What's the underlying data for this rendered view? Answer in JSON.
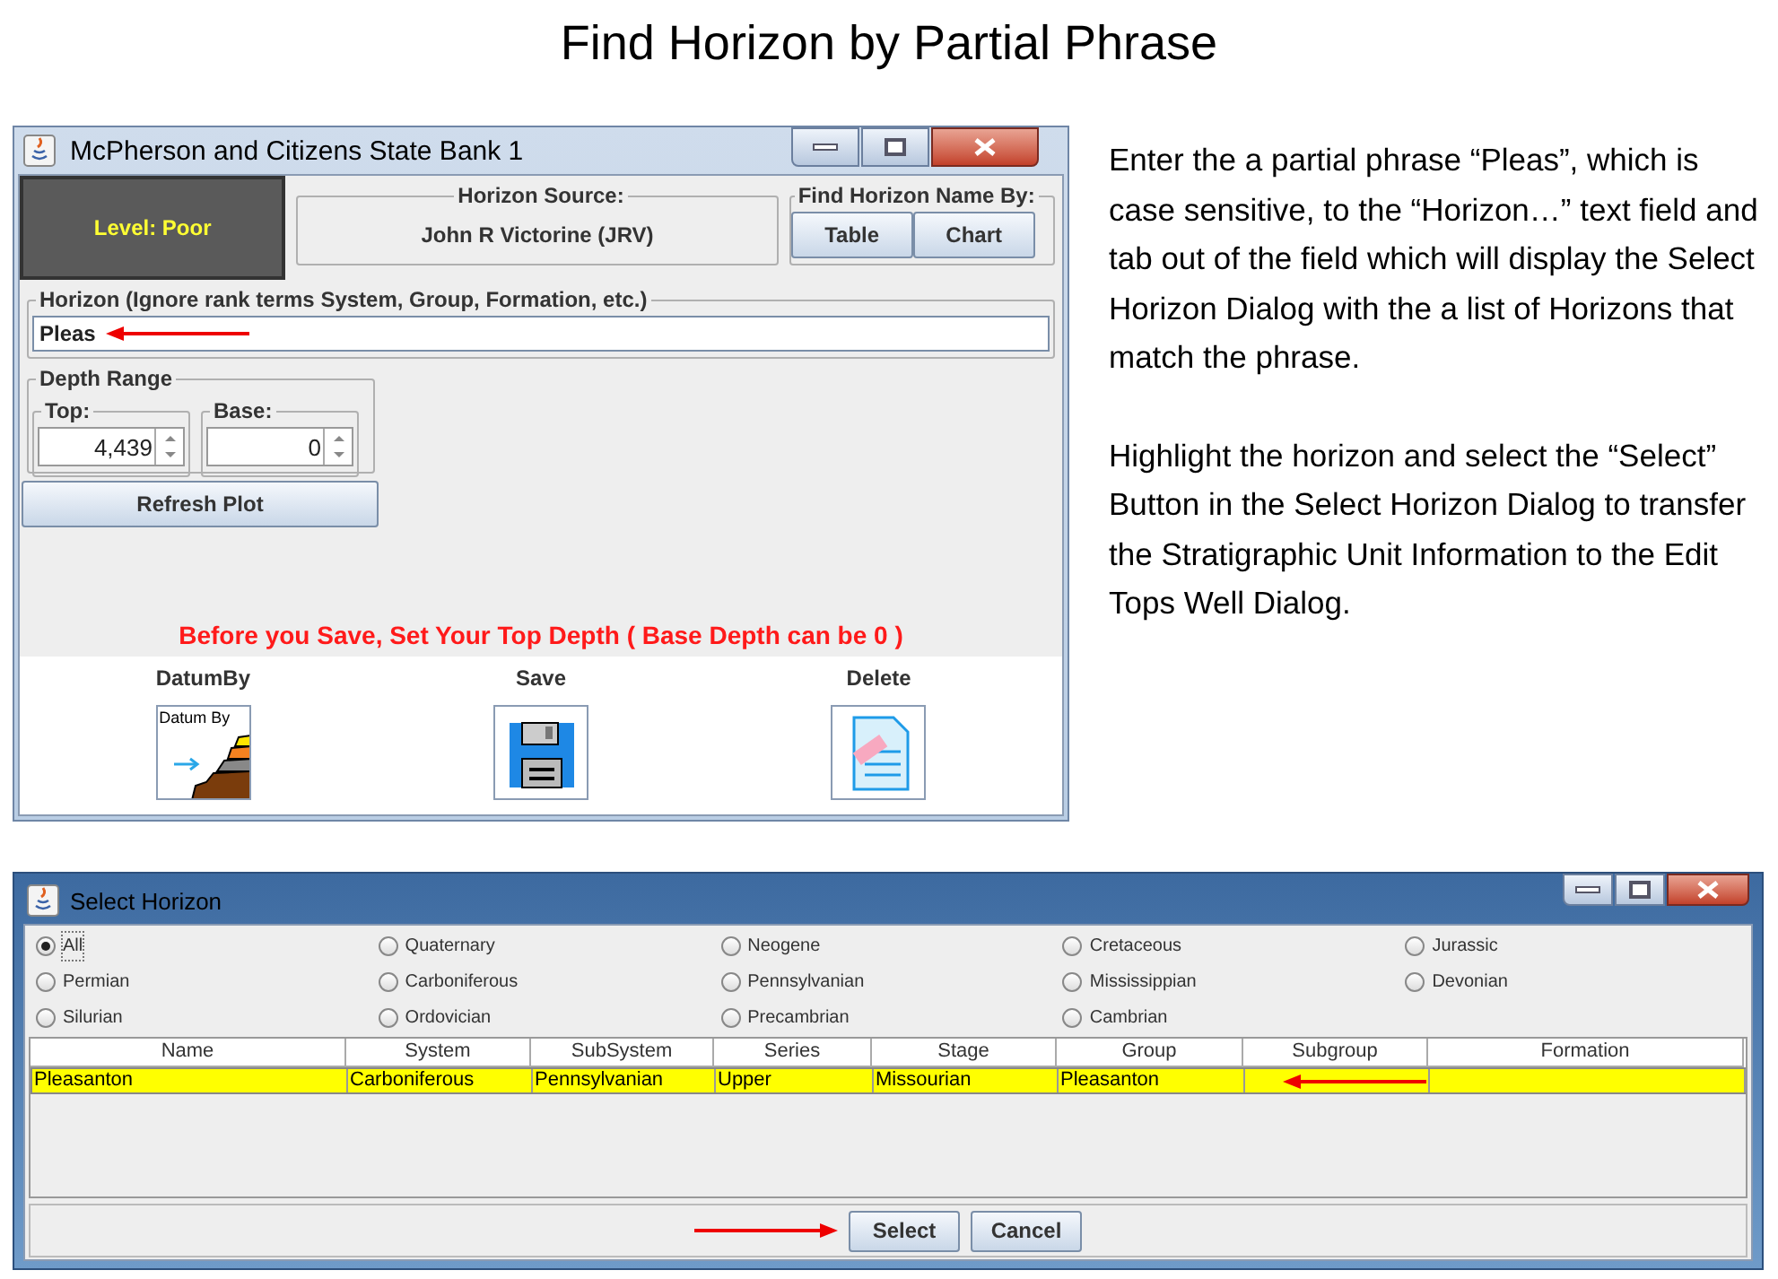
{
  "title": "Find Horizon by Partial Phrase",
  "edit_window": {
    "title": "McPherson and Citizens State Bank 1",
    "level": "Level: Poor",
    "source_label": "Horizon Source:",
    "source": "John R Victorine (JRV)",
    "find_label": "Find Horizon Name By:",
    "find_buttons": [
      "Table",
      "Chart"
    ],
    "horizon_label": "Horizon (Ignore rank terms System, Group, Formation, etc.)",
    "horizon_value": "Pleas",
    "depth_label": "Depth Range",
    "top_label": "Top:",
    "top_value": "4,439",
    "base_label": "Base:",
    "base_value": "0",
    "refresh": "Refresh Plot",
    "warning": "Before you Save, Set Your Top Depth ( Base Depth can be 0 )",
    "actions": [
      {
        "kind": "datum",
        "label": "DatumBy",
        "icon_text": "Datum By"
      },
      {
        "kind": "save",
        "label": "Save"
      },
      {
        "kind": "delete",
        "label": "Delete"
      }
    ]
  },
  "notes": [
    "Enter the a partial phrase “Pleas”, which is case sensitive, to the “Horizon…” text field and tab out of the field which will display the Select Horizon Dialog with the a list of Horizons that match the phrase.",
    "Highlight the horizon and select the “Select” Button in the Select Horizon Dialog to transfer the Stratigraphic Unit Information to the Edit Tops Well Dialog."
  ],
  "select_window": {
    "title": "Select Horizon",
    "periods": [
      {
        "label": "All",
        "selected": true
      },
      {
        "label": "Quaternary",
        "selected": false
      },
      {
        "label": "Neogene",
        "selected": false
      },
      {
        "label": "Cretaceous",
        "selected": false
      },
      {
        "label": "Jurassic",
        "selected": false
      },
      {
        "label": "Permian",
        "selected": false
      },
      {
        "label": "Carboniferous",
        "selected": false
      },
      {
        "label": "Pennsylvanian",
        "selected": false
      },
      {
        "label": "Mississippian",
        "selected": false
      },
      {
        "label": "Devonian",
        "selected": false
      },
      {
        "label": "Silurian",
        "selected": false
      },
      {
        "label": "Ordovician",
        "selected": false
      },
      {
        "label": "Precambrian",
        "selected": false
      },
      {
        "label": "Cambrian",
        "selected": false
      }
    ],
    "columns": [
      "Name",
      "System",
      "SubSystem",
      "Series",
      "Stage",
      "Group",
      "Subgroup",
      "Formation"
    ],
    "rows": [
      {
        "cells": [
          "Pleasanton",
          "Carboniferous",
          "Pennsylvanian",
          "Upper",
          "Missourian",
          "Pleasanton",
          "",
          ""
        ],
        "selected": true
      }
    ],
    "buttons": [
      "Select",
      "Cancel"
    ]
  }
}
